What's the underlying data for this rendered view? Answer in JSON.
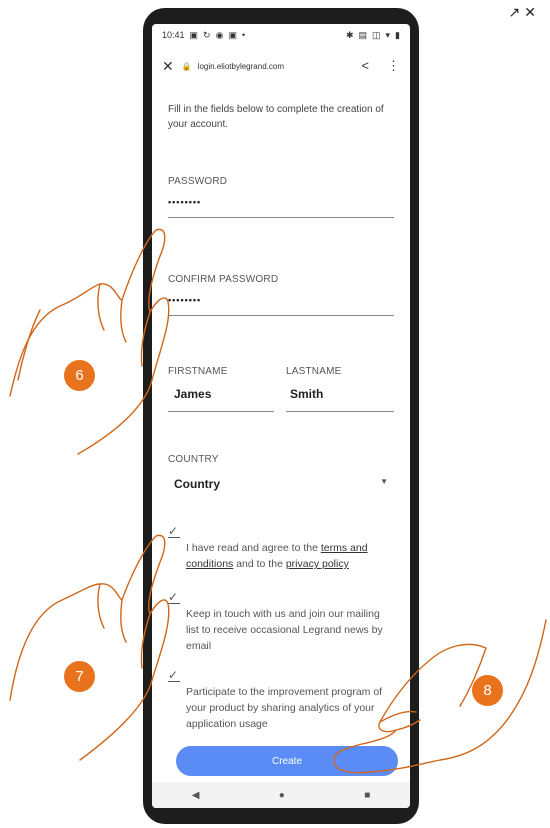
{
  "status": {
    "time": "10:41"
  },
  "browser": {
    "url": "login.eliotbylegrand.com"
  },
  "form": {
    "intro": "Fill in the fields below to complete the creation of your account.",
    "password_label": "PASSWORD",
    "password_value": "••••••••",
    "confirm_label": "CONFIRM PASSWORD",
    "confirm_value": "••••••••",
    "firstname_label": "FIRSTNAME",
    "firstname_value": "James",
    "lastname_label": "LASTNAME",
    "lastname_value": "Smith",
    "country_label": "COUNTRY",
    "country_value": "Country",
    "terms_text_1": "I have read and agree to the ",
    "terms_link": "terms and conditions",
    "terms_text_2": " and to the ",
    "privacy_link": "privacy policy",
    "newsletter_text": "Keep in touch with us and join our mailing list to receive occasional Legrand news by email",
    "analytics_text": "Participate to the improvement program of your product by sharing analytics of your application usage",
    "create_label": "Create"
  },
  "annotations": {
    "step1": "6",
    "step2": "7",
    "step3": "8"
  },
  "colors": {
    "accent": "#5b8cf5",
    "badge": "#e8731c"
  }
}
